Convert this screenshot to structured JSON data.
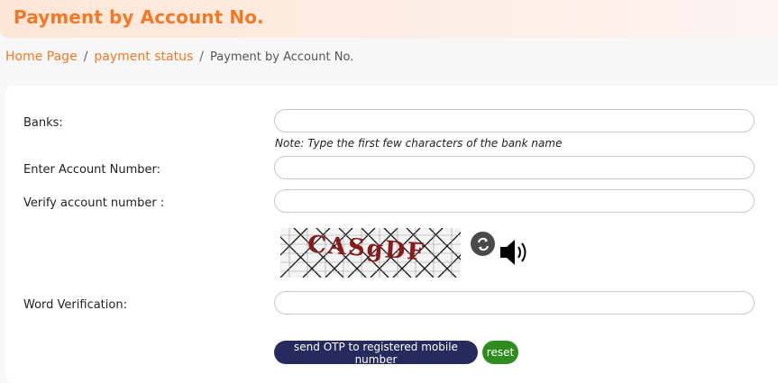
{
  "page": {
    "title": "Payment by Account No."
  },
  "breadcrumb": {
    "home": "Home Page",
    "status": "payment status",
    "current": "Payment by Account No.",
    "separator": "/"
  },
  "form": {
    "banks_label": "Banks:",
    "banks_value": "",
    "banks_note": "Note: Type the first few characters of the bank name",
    "account_label": "Enter Account Number:",
    "account_value": "",
    "verify_label": "Verify account number :",
    "verify_value": "",
    "captcha_text": "CASgDF",
    "word_label": "Word Verification:",
    "word_value": ""
  },
  "buttons": {
    "otp": "send OTP to registered mobile number",
    "reset": "reset"
  },
  "icons": {
    "refresh": "refresh-icon",
    "audio": "speaker-icon"
  },
  "colors": {
    "accent": "#f07a28",
    "otp_button": "#262a5c",
    "reset_button": "#2f8c1e"
  }
}
